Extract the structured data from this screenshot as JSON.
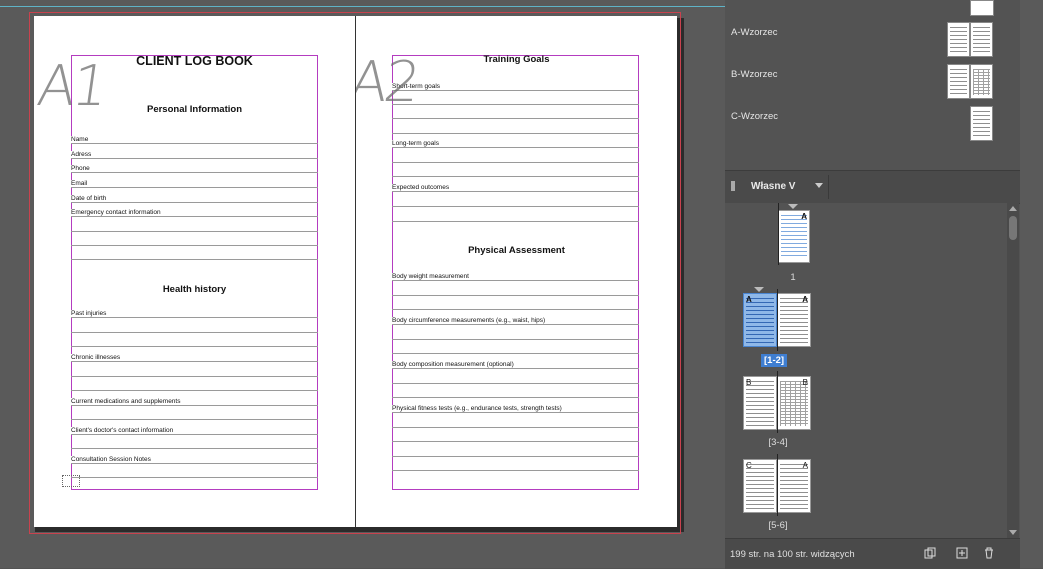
{
  "document": {
    "left_page": {
      "annotation": "A1",
      "title": "CLIENT LOG BOOK",
      "section_personal": "Personal Information",
      "personal_fields": [
        "Name",
        "Adress",
        "Phone",
        "Email",
        "Date of birth",
        "Emergency contact information"
      ],
      "section_health": "Health history",
      "health_fields": [
        "Past injuries",
        "Chronic illnesses",
        "Current medications and supplements",
        "Client's doctor's contact information",
        "Consultation Session Notes"
      ]
    },
    "right_page": {
      "annotation": "A2",
      "section_training": "Training Goals",
      "training_fields": [
        "Short-term goals",
        "Long-term goals",
        "Expected outcomes"
      ],
      "section_physical": "Physical Assessment",
      "physical_fields": [
        "Body weight measurement",
        "Body circumference measurements (e.g., waist, hips)",
        "Body composition measurement (optional)",
        "Physical fitness tests (e.g., endurance tests, strength tests)"
      ]
    }
  },
  "pages_panel": {
    "masters": [
      "A-Wzorzec",
      "B-Wzorzec",
      "C-Wzorzec"
    ],
    "section_name": "Własne V",
    "spreads": [
      {
        "caption": "1",
        "masters": [
          "A"
        ]
      },
      {
        "caption": "[1-2]",
        "masters": [
          "A",
          "A"
        ],
        "selected": true
      },
      {
        "caption": "[3-4]",
        "masters": [
          "B",
          "B"
        ]
      },
      {
        "caption": "[5-6]",
        "masters": [
          "C",
          "A"
        ]
      }
    ],
    "status": "199 str. na 100 str. widzących",
    "icons": [
      "page-size-icon",
      "new-page-icon",
      "delete-page-icon"
    ]
  }
}
